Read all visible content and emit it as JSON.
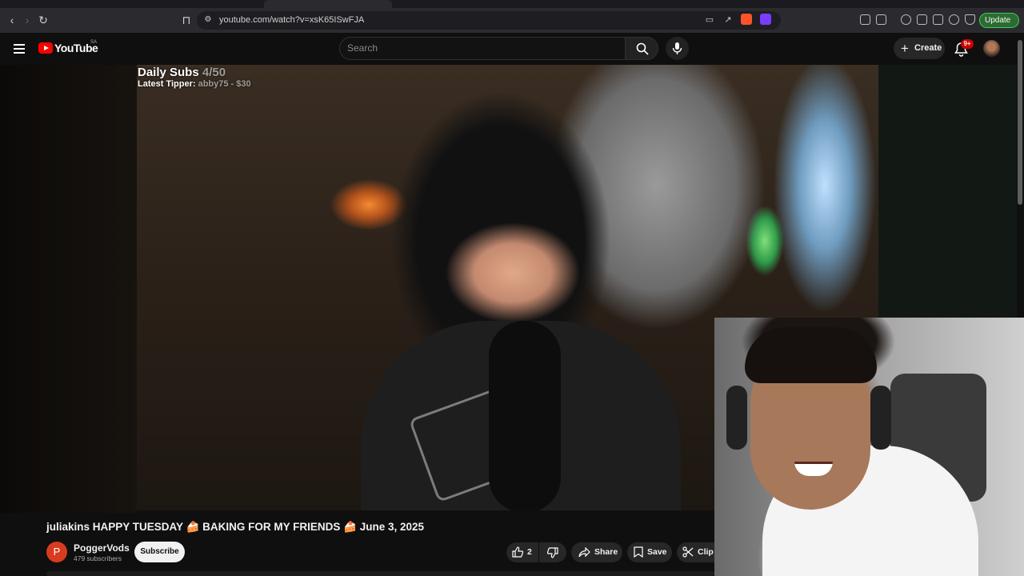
{
  "browser": {
    "url": "youtube.com/watch?v=xsK65ISwFJA",
    "update_label": "Update"
  },
  "youtube": {
    "logo_text": "YouTube",
    "country_code": "SA",
    "search_placeholder": "Search",
    "create_label": "Create",
    "notification_count": "9+"
  },
  "stream_overlay": {
    "daily_subs_label": "Daily Subs",
    "daily_subs_value": "4/50",
    "latest_tipper_label": "Latest Tipper:",
    "latest_tipper_value": "abby75 - $30"
  },
  "video": {
    "title": "juliakins HAPPY TUESDAY 🍰 BAKING FOR MY FRIENDS 🍰 June 3, 2025",
    "channel_name": "PoggerVods",
    "channel_initial": "P",
    "subscribers": "479 subscribers",
    "subscribe_label": "Subscribe",
    "like_count": "2",
    "share_label": "Share",
    "save_label": "Save",
    "clip_label": "Clip"
  },
  "colors": {
    "accent_red": "#ff0000",
    "update_green": "#3dcd58",
    "channel_avatar": "#d93b1f"
  }
}
